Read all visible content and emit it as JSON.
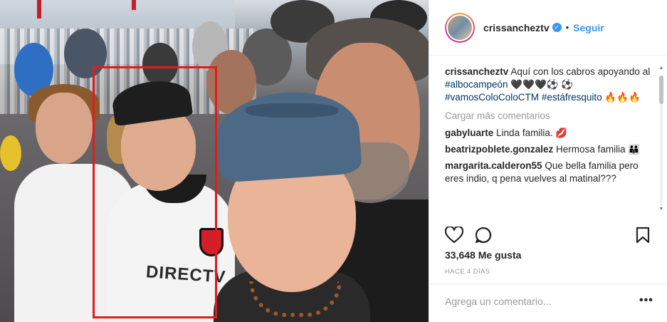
{
  "post": {
    "username": "crissancheztv",
    "follow_label": "Seguir",
    "separator": "•",
    "caption_user": "crissancheztv",
    "caption_parts": [
      {
        "text": " Aquí con los cabros apoyando al ",
        "tag": false
      },
      {
        "text": "#albocampeón",
        "tag": true
      },
      {
        "text": " 🖤🖤🖤⚽ ⚽ ",
        "tag": false
      },
      {
        "text": "#vamosColoColoCTM",
        "tag": true
      },
      {
        "text": " ",
        "tag": false
      },
      {
        "text": "#estáfresquito",
        "tag": true
      },
      {
        "text": " 🔥🔥🔥",
        "tag": false
      }
    ],
    "load_more": "Cargar más comentarios",
    "comments": [
      {
        "user": "gabyluarte",
        "text": "Linda familia. 💋"
      },
      {
        "user": "beatrizpoblete.gonzalez",
        "text": "Hermosa familia 👪"
      },
      {
        "user": "margarita.calderon55",
        "text": "Que bella familia pero eres indio, q pena vuelves al matinal???"
      }
    ],
    "likes": "33,648 Me gusta",
    "time": "HACE 4 DÍAS",
    "comment_placeholder": "Agrega un comentario...",
    "more_label": "•••"
  },
  "photo": {
    "sponsor_text": "DIRECTV",
    "club_badge": "COLO-COLO"
  },
  "icons": {
    "verified": "verified-badge-icon",
    "like": "heart-icon",
    "comment": "comment-bubble-icon",
    "save": "bookmark-icon"
  },
  "colors": {
    "link": "#3897f0",
    "hashtag": "#003569",
    "highlight_box": "#e21b1b"
  }
}
